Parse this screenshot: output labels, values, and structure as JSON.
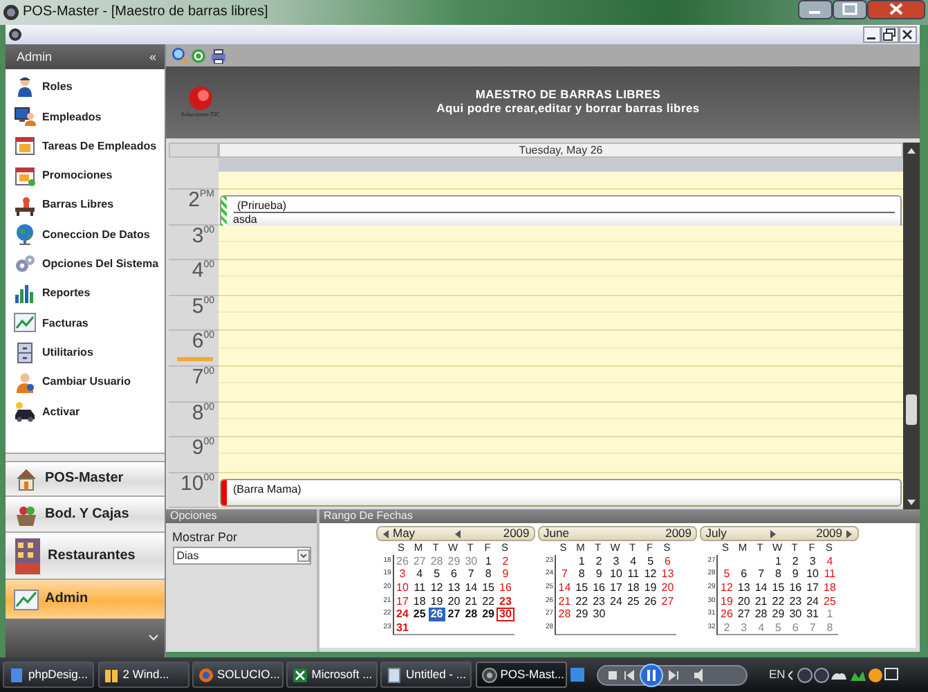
{
  "window": {
    "title": "POS-Master - [Maestro de barras libres]"
  },
  "sidebar": {
    "header": "Admin",
    "collapse": "«",
    "items": [
      {
        "label": "Roles"
      },
      {
        "label": "Empleados"
      },
      {
        "label": "Tareas De Empleados"
      },
      {
        "label": "Promociones"
      },
      {
        "label": "Barras Libres"
      },
      {
        "label": "Coneccion De Datos"
      },
      {
        "label": "Opciones Del Sistema"
      },
      {
        "label": "Reportes"
      },
      {
        "label": "Facturas"
      },
      {
        "label": "Utilitarios"
      },
      {
        "label": "Cambiar Usuario"
      },
      {
        "label": "Activar"
      }
    ],
    "groups": [
      {
        "label": "POS-Master",
        "selected": false
      },
      {
        "label": "Bod. Y Cajas",
        "selected": false
      },
      {
        "label": "Restaurantes",
        "selected": false
      },
      {
        "label": "Admin",
        "selected": true
      }
    ]
  },
  "header": {
    "logo_text": "Soluciones-TIC",
    "title": "MAESTRO DE BARRAS LIBRES",
    "subtitle": "Aqui podre crear,editar y borrar  barras libres"
  },
  "day_view": {
    "date": "Tuesday, May 26",
    "hours": [
      {
        "hour": "2",
        "suffix": "PM",
        "now": false,
        "appointments": [
          {
            "subject": "(Prirueba)",
            "description": "asda",
            "kind": "striped",
            "color": "#33cc33"
          }
        ]
      },
      {
        "hour": "3",
        "suffix": "00",
        "now": false
      },
      {
        "hour": "4",
        "suffix": "00",
        "now": false
      },
      {
        "hour": "5",
        "suffix": "00",
        "now": false
      },
      {
        "hour": "6",
        "suffix": "00",
        "now": true
      },
      {
        "hour": "7",
        "suffix": "00",
        "now": false
      },
      {
        "hour": "8",
        "suffix": "00",
        "now": false
      },
      {
        "hour": "9",
        "suffix": "00",
        "now": false
      },
      {
        "hour": "10",
        "suffix": "00",
        "now": false,
        "appointments": [
          {
            "subject": "(Barra Mama)",
            "kind": "solid",
            "color": "#ee0000"
          }
        ]
      }
    ]
  },
  "options": {
    "title": "Opciones",
    "label": "Mostrar Por",
    "value": "Dias"
  },
  "date_range": {
    "title": "Rango De Fechas",
    "months": [
      {
        "month": "May",
        "year": "2009",
        "prev": true,
        "next": false,
        "weekdays": [
          "S",
          "M",
          "T",
          "W",
          "T",
          "F",
          "S"
        ],
        "weeks": [
          {
            "week": "18",
            "days": [
              {
                "d": "26",
                "kind": "other",
                "selected": false
              },
              {
                "d": "27",
                "kind": "other",
                "selected": false
              },
              {
                "d": "28",
                "kind": "other",
                "selected": false
              },
              {
                "d": "29",
                "kind": "other",
                "selected": false
              },
              {
                "d": "30",
                "kind": "other",
                "selected": false
              },
              {
                "d": "1",
                "kind": "weekday",
                "selected": false
              },
              {
                "d": "2",
                "kind": "weekend",
                "selected": false
              }
            ]
          },
          {
            "week": "19",
            "days": [
              {
                "d": "3",
                "kind": "weekend",
                "selected": false
              },
              {
                "d": "4",
                "kind": "weekday",
                "selected": false
              },
              {
                "d": "5",
                "kind": "weekday",
                "selected": false
              },
              {
                "d": "6",
                "kind": "weekday",
                "selected": false
              },
              {
                "d": "7",
                "kind": "weekday",
                "selected": false
              },
              {
                "d": "8",
                "kind": "weekday",
                "selected": false
              },
              {
                "d": "9",
                "kind": "weekend",
                "selected": false
              }
            ]
          },
          {
            "week": "20",
            "days": [
              {
                "d": "10",
                "kind": "weekend",
                "selected": false
              },
              {
                "d": "11",
                "kind": "weekday",
                "selected": false
              },
              {
                "d": "12",
                "kind": "weekday",
                "selected": false
              },
              {
                "d": "13",
                "kind": "weekday",
                "selected": false
              },
              {
                "d": "14",
                "kind": "weekday",
                "selected": false
              },
              {
                "d": "15",
                "kind": "weekday",
                "selected": false
              },
              {
                "d": "16",
                "kind": "weekend",
                "selected": false
              }
            ]
          },
          {
            "week": "21",
            "days": [
              {
                "d": "17",
                "kind": "weekend",
                "selected": false
              },
              {
                "d": "18",
                "kind": "weekday",
                "selected": false
              },
              {
                "d": "19",
                "kind": "weekday",
                "selected": false
              },
              {
                "d": "20",
                "kind": "weekday",
                "selected": false
              },
              {
                "d": "21",
                "kind": "weekday",
                "selected": false
              },
              {
                "d": "22",
                "kind": "weekday",
                "selected": false
              },
              {
                "d": "23",
                "kind": "range-weekend",
                "selected": false
              }
            ]
          },
          {
            "week": "22",
            "days": [
              {
                "d": "24",
                "kind": "range-weekend",
                "selected": false
              },
              {
                "d": "25",
                "kind": "range-weekday",
                "selected": false
              },
              {
                "d": "26",
                "kind": "range-weekday",
                "selected": true
              },
              {
                "d": "27",
                "kind": "range-weekday",
                "selected": false
              },
              {
                "d": "28",
                "kind": "range-weekday",
                "selected": false
              },
              {
                "d": "29",
                "kind": "range-weekday",
                "selected": false
              },
              {
                "d": "30",
                "kind": "today",
                "selected": false
              }
            ]
          },
          {
            "week": "23",
            "days": [
              {
                "d": "31",
                "kind": "range-weekend",
                "selected": false
              }
            ]
          }
        ]
      },
      {
        "month": "June",
        "year": "2009",
        "prev": false,
        "next": false,
        "weekdays": [
          "S",
          "M",
          "T",
          "W",
          "T",
          "F",
          "S"
        ],
        "weeks": [
          {
            "week": "23",
            "days": [
              {
                "d": "1",
                "kind": "weekday",
                "selected": false
              },
              {
                "d": "2",
                "kind": "weekday",
                "selected": false
              },
              {
                "d": "3",
                "kind": "weekday",
                "selected": false
              },
              {
                "d": "4",
                "kind": "weekday",
                "selected": false
              },
              {
                "d": "5",
                "kind": "weekday",
                "selected": false
              },
              {
                "d": "6",
                "kind": "weekend",
                "selected": false
              }
            ]
          },
          {
            "week": "24",
            "days": [
              {
                "d": "7",
                "kind": "weekend",
                "selected": false
              },
              {
                "d": "8",
                "kind": "weekday",
                "selected": false
              },
              {
                "d": "9",
                "kind": "weekday",
                "selected": false
              },
              {
                "d": "10",
                "kind": "weekday",
                "selected": false
              },
              {
                "d": "11",
                "kind": "weekday",
                "selected": false
              },
              {
                "d": "12",
                "kind": "weekday",
                "selected": false
              },
              {
                "d": "13",
                "kind": "weekend",
                "selected": false
              }
            ]
          },
          {
            "week": "25",
            "days": [
              {
                "d": "14",
                "kind": "weekend",
                "selected": false
              },
              {
                "d": "15",
                "kind": "weekday",
                "selected": false
              },
              {
                "d": "16",
                "kind": "weekday",
                "selected": false
              },
              {
                "d": "17",
                "kind": "weekday",
                "selected": false
              },
              {
                "d": "18",
                "kind": "weekday",
                "selected": false
              },
              {
                "d": "19",
                "kind": "weekday",
                "selected": false
              },
              {
                "d": "20",
                "kind": "weekend",
                "selected": false
              }
            ]
          },
          {
            "week": "26",
            "days": [
              {
                "d": "21",
                "kind": "weekend",
                "selected": false
              },
              {
                "d": "22",
                "kind": "weekday",
                "selected": false
              },
              {
                "d": "23",
                "kind": "weekday",
                "selected": false
              },
              {
                "d": "24",
                "kind": "weekday",
                "selected": false
              },
              {
                "d": "25",
                "kind": "weekday",
                "selected": false
              },
              {
                "d": "26",
                "kind": "weekday",
                "selected": false
              },
              {
                "d": "27",
                "kind": "weekend",
                "selected": false
              }
            ]
          },
          {
            "week": "27",
            "days": [
              {
                "d": "28",
                "kind": "weekend",
                "selected": false
              },
              {
                "d": "29",
                "kind": "weekday",
                "selected": false
              },
              {
                "d": "30",
                "kind": "weekday",
                "selected": false
              }
            ]
          },
          {
            "week": "28"
          }
        ]
      },
      {
        "month": "July",
        "year": "2009",
        "prev": false,
        "next": true,
        "weekdays": [
          "S",
          "M",
          "T",
          "W",
          "T",
          "F",
          "S"
        ],
        "weeks": [
          {
            "week": "27",
            "days": [
              {
                "d": "1",
                "kind": "weekday",
                "selected": false
              },
              {
                "d": "2",
                "kind": "weekday",
                "selected": false
              },
              {
                "d": "3",
                "kind": "weekday",
                "selected": false
              },
              {
                "d": "4",
                "kind": "weekend",
                "selected": false
              }
            ]
          },
          {
            "week": "28",
            "days": [
              {
                "d": "5",
                "kind": "weekend",
                "selected": false
              },
              {
                "d": "6",
                "kind": "weekday",
                "selected": false
              },
              {
                "d": "7",
                "kind": "weekday",
                "selected": false
              },
              {
                "d": "8",
                "kind": "weekday",
                "selected": false
              },
              {
                "d": "9",
                "kind": "weekday",
                "selected": false
              },
              {
                "d": "10",
                "kind": "weekday",
                "selected": false
              },
              {
                "d": "11",
                "kind": "weekend",
                "selected": false
              }
            ]
          },
          {
            "week": "29",
            "days": [
              {
                "d": "12",
                "kind": "weekend",
                "selected": false
              },
              {
                "d": "13",
                "kind": "weekday",
                "selected": false
              },
              {
                "d": "14",
                "kind": "weekday",
                "selected": false
              },
              {
                "d": "15",
                "kind": "weekday",
                "selected": false
              },
              {
                "d": "16",
                "kind": "weekday",
                "selected": false
              },
              {
                "d": "17",
                "kind": "weekday",
                "selected": false
              },
              {
                "d": "18",
                "kind": "weekend",
                "selected": false
              }
            ]
          },
          {
            "week": "30",
            "days": [
              {
                "d": "19",
                "kind": "weekend",
                "selected": false
              },
              {
                "d": "20",
                "kind": "weekday",
                "selected": false
              },
              {
                "d": "21",
                "kind": "weekday",
                "selected": false
              },
              {
                "d": "22",
                "kind": "weekday",
                "selected": false
              },
              {
                "d": "23",
                "kind": "weekday",
                "selected": false
              },
              {
                "d": "24",
                "kind": "weekday",
                "selected": false
              },
              {
                "d": "25",
                "kind": "weekend",
                "selected": false
              }
            ]
          },
          {
            "week": "31",
            "days": [
              {
                "d": "26",
                "kind": "weekend",
                "selected": false
              },
              {
                "d": "27",
                "kind": "weekday",
                "selected": false
              },
              {
                "d": "28",
                "kind": "weekday",
                "selected": false
              },
              {
                "d": "29",
                "kind": "weekday",
                "selected": false
              },
              {
                "d": "30",
                "kind": "weekday",
                "selected": false
              },
              {
                "d": "31",
                "kind": "weekday",
                "selected": false
              },
              {
                "d": "1",
                "kind": "other",
                "selected": false
              }
            ]
          },
          {
            "week": "32",
            "days": [
              {
                "d": "2",
                "kind": "other",
                "selected": false
              },
              {
                "d": "3",
                "kind": "other",
                "selected": false
              },
              {
                "d": "4",
                "kind": "other",
                "selected": false
              },
              {
                "d": "5",
                "kind": "other",
                "selected": false
              },
              {
                "d": "6",
                "kind": "other",
                "selected": false
              },
              {
                "d": "7",
                "kind": "other",
                "selected": false
              },
              {
                "d": "8",
                "kind": "other",
                "selected": false
              }
            ]
          }
        ]
      }
    ]
  },
  "taskbar": {
    "items": [
      {
        "label": "phpDesig...",
        "selected": false
      },
      {
        "label": "2 Wind...",
        "selected": false
      },
      {
        "label": "SOLUCIO...",
        "selected": false
      },
      {
        "label": "Microsoft ...",
        "selected": false
      },
      {
        "label": "Untitled - ...",
        "selected": false
      },
      {
        "label": "POS-Mast...",
        "selected": true
      }
    ],
    "language": "EN"
  }
}
